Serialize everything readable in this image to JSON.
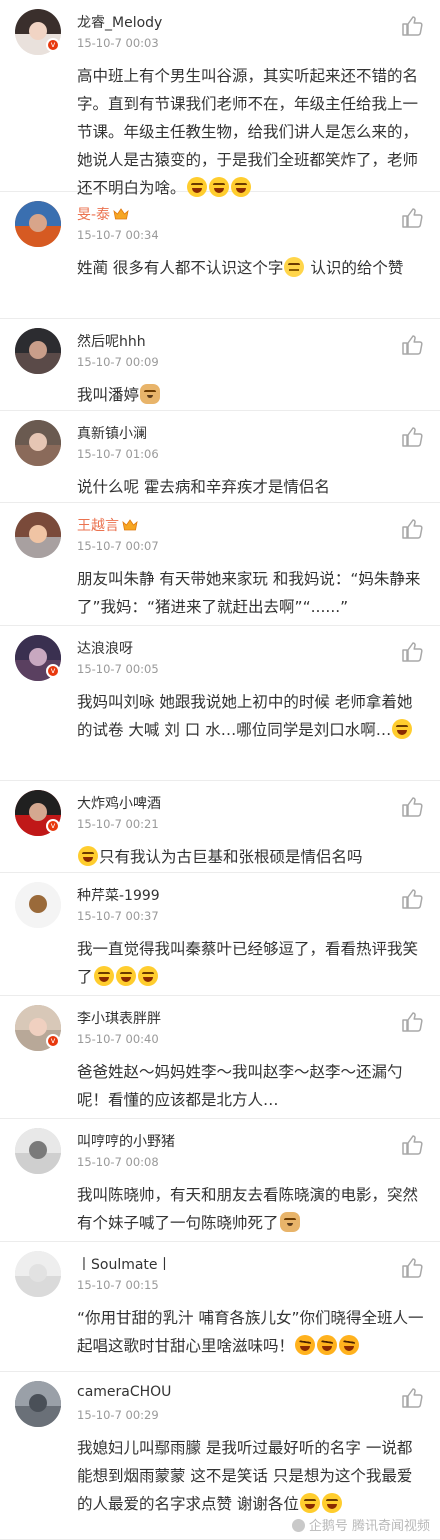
{
  "comments": [
    {
      "username": "龙睿_Melody",
      "vip": false,
      "time": "15-10-7 00:03",
      "verified": true,
      "text": "高中班上有个男生叫谷源，其实听起来还不错的名字。直到有节课我们老师不在，年级主任给我上一节课。年级主任教生物，给我们讲人是怎么来的，她说人是古猿变的，于是我们全班都笑炸了，老师还不明白为啥。",
      "emojis": [
        "laugh",
        "laugh",
        "laugh"
      ],
      "avatar": {
        "top": "#3a2f2c",
        "face": "#f1d4c4",
        "bot": "#e9e1dc"
      }
    },
    {
      "username": "旻-泰",
      "vip": true,
      "time": "15-10-7 00:34",
      "verified": false,
      "text": "姓蔺 很多有人都不认识这个字",
      "emojis": [
        "think"
      ],
      "text2": " 认识的给个赞",
      "avatar": {
        "top": "#3a6fb0",
        "face": "#d8a58a",
        "bot": "#d65a22"
      }
    },
    {
      "username": "然后呢hhh",
      "vip": false,
      "time": "15-10-7 00:09",
      "verified": false,
      "text": "我叫潘婷",
      "emojis": [
        "doge"
      ],
      "avatar": {
        "top": "#2c2c30",
        "face": "#c99e8a",
        "bot": "#5a4a48"
      }
    },
    {
      "username": "真新镇小澜",
      "vip": false,
      "time": "15-10-7 01:06",
      "verified": false,
      "text": "说什么呢 霍去病和辛弃疾才是情侣名",
      "emojis": [],
      "avatar": {
        "top": "#6a5a50",
        "face": "#e6c6b4",
        "bot": "#8a6a5a"
      }
    },
    {
      "username": "王越言",
      "vip": true,
      "time": "15-10-7 00:07",
      "verified": false,
      "text": "朋友叫朱静 有天带她来家玩 和我妈说：“妈朱静来了”我妈：“猪进来了就赶出去啊”“......”",
      "emojis": [],
      "avatar": {
        "top": "#7a4a3a",
        "face": "#f0c4a4",
        "bot": "#a8a0a0"
      }
    },
    {
      "username": "达浪浪呀",
      "vip": false,
      "time": "15-10-7 00:05",
      "verified": true,
      "text": "我妈叫刘咏 她跟我说她上初中的时候 老师拿着她的试卷 大喊 刘 口 水…哪位同学是刘口水啊…",
      "emojis": [
        "laugh"
      ],
      "avatar": {
        "top": "#3a3050",
        "face": "#c8a8c0",
        "bot": "#5a4060"
      }
    },
    {
      "username": "大炸鸡小啤酒",
      "vip": false,
      "time": "15-10-7 00:21",
      "verified": true,
      "text": "只有我认为古巨基和张根硕是情侣名吗",
      "emojis": [
        "laugh"
      ],
      "emojiFirst": true,
      "avatar": {
        "top": "#202020",
        "face": "#d4a890",
        "bot": "#c01818"
      }
    },
    {
      "username": "种芹菜-1999",
      "vip": false,
      "time": "15-10-7 00:37",
      "verified": false,
      "text": "我一直觉得我叫秦蔡叶已经够逗了，看看热评我笑了",
      "emojis": [
        "laugh",
        "laugh",
        "laugh"
      ],
      "avatar": {
        "top": "#f4f4f4",
        "face": "#9a6a3a",
        "bot": "#f4f4f4"
      }
    },
    {
      "username": "李小琪表胖胖",
      "vip": false,
      "time": "15-10-7 00:40",
      "verified": true,
      "text": "爸爸姓赵～妈妈姓李～我叫赵李～赵李～还漏勺呢！看懂的应该都是北方人…",
      "emojis": [],
      "avatar": {
        "top": "#d8c8b8",
        "face": "#f0d0c0",
        "bot": "#b8a898"
      }
    },
    {
      "username": "叫哼哼的小野猪",
      "vip": false,
      "time": "15-10-7 00:08",
      "verified": false,
      "text": "我叫陈晓帅，有天和朋友去看陈晓演的电影，突然有个妹子喊了一句陈晓帅死了",
      "emojis": [
        "doge"
      ],
      "avatar": {
        "top": "#e8e8e8",
        "face": "#7a7a7a",
        "bot": "#cfcfcf"
      }
    },
    {
      "username": "丨Soulmate丨",
      "vip": false,
      "time": "15-10-7 00:15",
      "verified": false,
      "text": "“你用甘甜的乳汁 哺育各族儿女”你们晓得全班人一起唱这歌时甘甜心里啥滋味吗！",
      "emojis": [
        "angry",
        "angry",
        "angry"
      ],
      "avatar": {
        "top": "#eeeeee",
        "face": "#e2e2e2",
        "bot": "#dadada"
      }
    },
    {
      "username": "cameraCHOU",
      "vip": false,
      "time": "15-10-7 00:29",
      "verified": false,
      "text": "我媳妇儿叫鄢雨朦 是我听过最好听的名字 一说都能想到烟雨蒙蒙 这不是笑话 只是想为这个我最爱的人最爱的名字求点赞 谢谢各位",
      "emojis": [
        "laugh",
        "laugh"
      ],
      "avatar": {
        "top": "#9aa0a8",
        "face": "#4a5058",
        "bot": "#6a7078"
      }
    }
  ],
  "watermark": "企鹅号 腾讯奇闻视频",
  "icons": {
    "like": "thumbs-up-icon",
    "crown": "crown-icon",
    "verified": "verified-badge-icon"
  }
}
